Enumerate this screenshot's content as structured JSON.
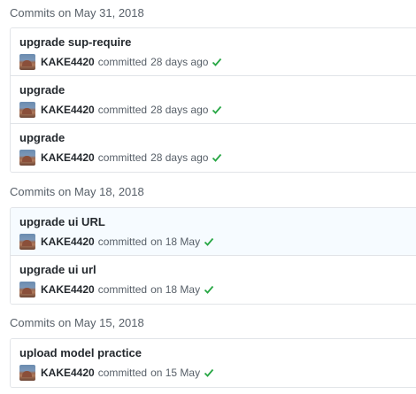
{
  "groups": [
    {
      "heading": "Commits on May 31, 2018",
      "commits": [
        {
          "title": "upgrade sup-require",
          "author": "KAKE4420",
          "verb": "committed",
          "when": "28 days ago",
          "status": "success"
        },
        {
          "title": "upgrade",
          "author": "KAKE4420",
          "verb": "committed",
          "when": "28 days ago",
          "status": "success"
        },
        {
          "title": "upgrade",
          "author": "KAKE4420",
          "verb": "committed",
          "when": "28 days ago",
          "status": "success"
        }
      ]
    },
    {
      "heading": "Commits on May 18, 2018",
      "commits": [
        {
          "title": "upgrade ui URL",
          "author": "KAKE4420",
          "verb": "committed",
          "when": "on 18 May",
          "status": "success"
        },
        {
          "title": "upgrade ui url",
          "author": "KAKE4420",
          "verb": "committed",
          "when": "on 18 May",
          "status": "success"
        }
      ]
    },
    {
      "heading": "Commits on May 15, 2018",
      "commits": [
        {
          "title": "upload model practice",
          "author": "KAKE4420",
          "verb": "committed",
          "when": "on 15 May",
          "status": "success"
        }
      ]
    }
  ],
  "colors": {
    "success_check": "#28a745",
    "highlight_row": "#f6fbff",
    "border": "#e1e4e8",
    "muted_text": "#586069"
  },
  "icons": {
    "avatar": "user-avatar",
    "status": "check-icon"
  }
}
